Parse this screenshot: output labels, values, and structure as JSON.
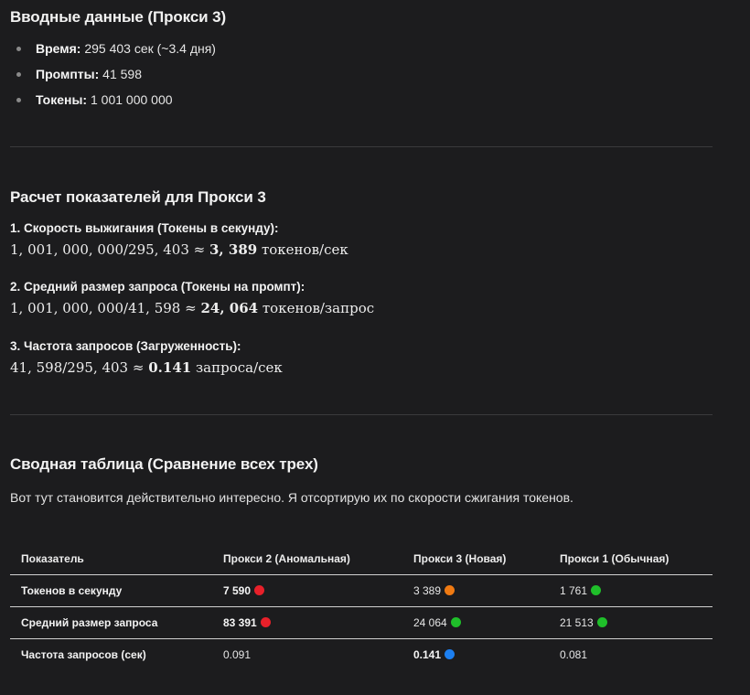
{
  "intro_section": {
    "title": "Вводные данные (Прокси 3)",
    "items": [
      {
        "label": "Время:",
        "value": "295 403 сек (~3.4 дня)"
      },
      {
        "label": "Промпты:",
        "value": "41 598"
      },
      {
        "label": "Токены:",
        "value": "1 001 000 000"
      }
    ]
  },
  "calc_section": {
    "title": "Расчет показателей для Прокси 3",
    "metrics": [
      {
        "title": "1. Скорость выжигания (Токены в секунду):",
        "formula": "1, 001, 000, 000/295, 403 ≈ ",
        "result": "3, 389",
        "unit": " токенов/сек"
      },
      {
        "title": "2. Средний размер запроса (Токены на промпт):",
        "formula": "1, 001, 000, 000/41, 598 ≈ ",
        "result": "24, 064",
        "unit": " токенов/запрос"
      },
      {
        "title": "3. Частота запросов (Загруженность):",
        "formula": "41, 598/295, 403 ≈ ",
        "result": "0.141",
        "unit": " запроса/сек"
      }
    ]
  },
  "summary_section": {
    "title": "Сводная таблица (Сравнение всех трех)",
    "intro": "Вот тут становится действительно интересно. Я отсортирую их по скорости сжигания токенов.",
    "headers": [
      "Показатель",
      "Прокси 2 (Аномальная)",
      "Прокси 3 (Новая)",
      "Прокси 1 (Обычная)"
    ],
    "rows": [
      {
        "label": "Токенов в секунду",
        "cells": [
          {
            "value": "7 590",
            "bold": true,
            "indicator": "red-circle"
          },
          {
            "value": "3 389",
            "bold": false,
            "indicator": "orange-circle"
          },
          {
            "value": "1 761",
            "bold": false,
            "indicator": "green-circle"
          }
        ]
      },
      {
        "label": "Средний размер запроса",
        "cells": [
          {
            "value": "83 391",
            "bold": true,
            "indicator": "red-circle"
          },
          {
            "value": "24 064",
            "bold": false,
            "indicator": "green-circle"
          },
          {
            "value": "21 513",
            "bold": false,
            "indicator": "green-circle"
          }
        ]
      },
      {
        "label": "Частота запросов (сек)",
        "cells": [
          {
            "value": "0.091",
            "bold": false,
            "indicator": null
          },
          {
            "value": "0.141",
            "bold": true,
            "indicator": "blue-circle"
          },
          {
            "value": "0.081",
            "bold": false,
            "indicator": null
          }
        ]
      }
    ]
  },
  "indicator_colors": {
    "red-circle": "#e8202a",
    "orange-circle": "#f07a12",
    "green-circle": "#1fbf2a",
    "blue-circle": "#1c7ff0"
  }
}
